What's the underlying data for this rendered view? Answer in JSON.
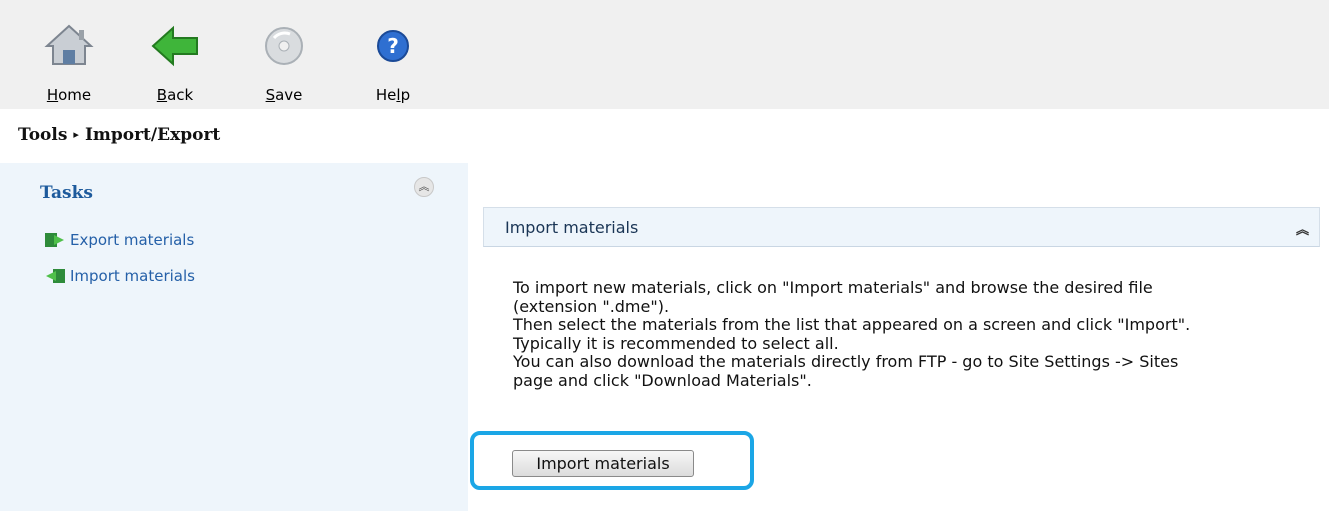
{
  "toolbar": {
    "home_label": "Home",
    "home_key": "H",
    "home_rest": "ome",
    "back_key": "B",
    "back_rest": "ack",
    "save_key": "S",
    "save_rest": "ave",
    "help_pre": "He",
    "help_key": "l",
    "help_rest": "p"
  },
  "breadcrumb": {
    "parent": "Tools",
    "separator": "▸",
    "current": "Import/Export"
  },
  "tasks": {
    "title": "Tasks",
    "items": [
      {
        "label": "Export materials",
        "icon": "export-icon"
      },
      {
        "label": "Import materials",
        "icon": "import-icon"
      }
    ]
  },
  "panel": {
    "title": "Import materials",
    "description": [
      "To import new materials, click on \"Import materials\" and browse the desired file",
      "(extension \".dme\").",
      "Then select the materials from the list that appeared on a screen and click \"Import\".",
      "Typically it is recommended to select all.",
      "You can also download the materials directly from FTP - go to Site Settings -> Sites",
      "page and click \"Download Materials\"."
    ],
    "button_label": "Import materials"
  },
  "colors": {
    "accent": "#1ba6e6",
    "link": "#2560a8",
    "tasks_title": "#1d5a9c",
    "panel_bg": "#eef5fb"
  }
}
